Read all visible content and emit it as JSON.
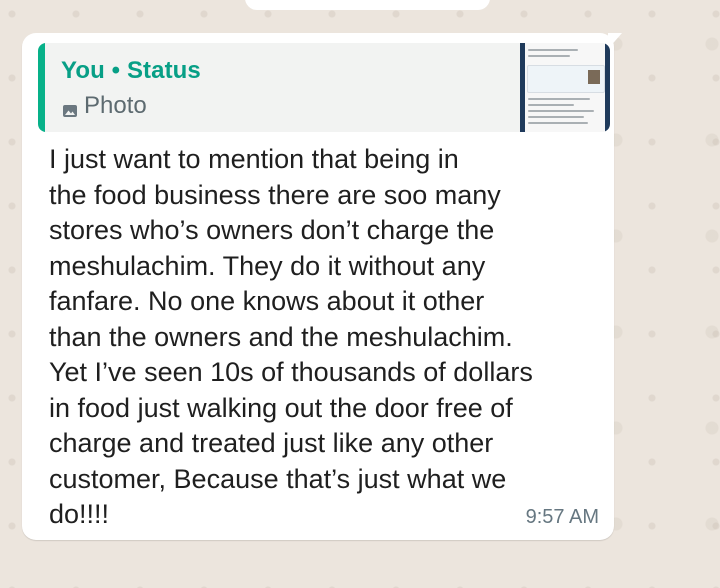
{
  "chat": {
    "reply_quote": {
      "sender": "You",
      "separator": "•",
      "context": "Status",
      "media_label": "Photo",
      "media_icon": "photo-icon"
    },
    "message_lines": [
      "I just want to mention that being in",
      "the food business there are soo many",
      "stores who’s owners don’t charge the",
      "meshulachim.  They do it without any",
      "fanfare. No one knows about it other",
      "than the owners and the meshulachim.",
      "Yet I’ve seen 10s of thousands of dollars",
      "in food just walking out the door free of",
      "charge and treated just like any other",
      "customer, Because that’s just what we",
      "do!!!!"
    ],
    "timestamp": "9:57 AM"
  },
  "colors": {
    "wallpaper": "#ece5dd",
    "bubble": "#ffffff",
    "quote_accent": "#07b189",
    "quote_title": "#079f86",
    "meta_text": "#667781"
  }
}
